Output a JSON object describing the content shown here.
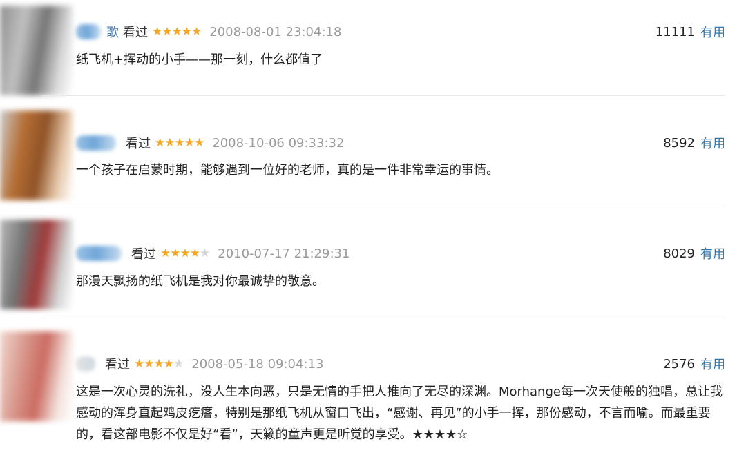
{
  "reviews": [
    {
      "name": "歌",
      "status": "看过",
      "rating": 5,
      "time": "2008-08-01 23:04:18",
      "votes": "11111",
      "useful": "有用",
      "content": "纸飞机+挥动的小手——那一刻，什么都值了"
    },
    {
      "name": "",
      "status": "看过",
      "rating": 5,
      "time": "2008-10-06 09:33:32",
      "votes": "8592",
      "useful": "有用",
      "content": "一个孩子在启蒙时期，能够遇到一位好的老师，真的是一件非常幸运的事情。"
    },
    {
      "name": "",
      "status": "看过",
      "rating": 4,
      "time": "2010-07-17 21:29:31",
      "votes": "8029",
      "useful": "有用",
      "content": "那漫天飘扬的纸飞机是我对你最诚挚的敬意。"
    },
    {
      "name": "",
      "status": "看过",
      "rating": 4,
      "time": "2008-05-18 09:04:13",
      "votes": "2576",
      "useful": "有用",
      "content": "这是一次心灵的洗礼，没人生本向恶，只是无情的手把人推向了无尽的深渊。Morhange每一次天使般的独唱，总让我感动的浑身直起鸡皮疙瘩，特别是那纸飞机从窗口飞出，“感谢、再见”的小手一挥，那份感动，不言而喻。而最重要的，看这部电影不仅是好“看”，天籁的童声更是听觉的享受。★★★★☆"
    }
  ],
  "colors": {
    "star_on": "#f5a623",
    "star_off": "#d4d4d4",
    "link": "#3377aa",
    "timestamp": "#9b9b9b"
  },
  "icons": [
    "avatar",
    "star-icon"
  ]
}
